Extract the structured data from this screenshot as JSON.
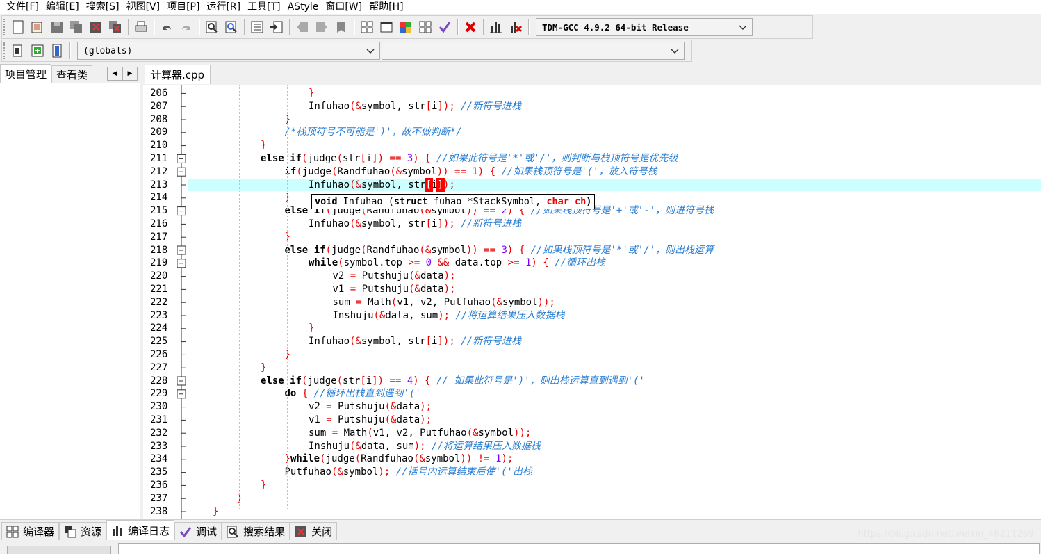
{
  "menu": [
    "文件[F]",
    "编辑[E]",
    "搜索[S]",
    "视图[V]",
    "项目[P]",
    "运行[R]",
    "工具[T]",
    "AStyle",
    "窗口[W]",
    "帮助[H]"
  ],
  "toolbar": {
    "compiler": "TDM-GCC 4.9.2 64-bit Release",
    "scope": "(globals)",
    "member": ""
  },
  "left_panel": {
    "tabs": [
      "项目管理",
      "查看类"
    ]
  },
  "editor": {
    "tab": "计算器.cpp",
    "tooltip": {
      "return_type": "void",
      "func": "Infuhao",
      "params_open": "(",
      "kw_struct": "struct",
      "p1": "fuhao *StackSymbol, ",
      "kw_char": "char",
      "p2": "ch",
      "close": ")"
    },
    "lines": [
      {
        "n": "206",
        "indent": 4,
        "code": [
          [
            "o",
            "}"
          ]
        ]
      },
      {
        "n": "207",
        "indent": 4,
        "code": [
          [
            "t",
            "Infuhao"
          ],
          [
            "o",
            "(&"
          ],
          [
            "t",
            "symbol, str"
          ],
          [
            "o",
            "["
          ],
          [
            "t",
            "i"
          ],
          [
            "o",
            "]);"
          ],
          [
            "t",
            " "
          ],
          [
            "c",
            "//新符号进栈"
          ]
        ]
      },
      {
        "n": "208",
        "indent": 3,
        "code": [
          [
            "o",
            "}"
          ]
        ]
      },
      {
        "n": "209",
        "indent": 3,
        "code": [
          [
            "c",
            "/*栈顶符号不可能是')'，故不做判断*/"
          ]
        ]
      },
      {
        "n": "210",
        "indent": 2,
        "code": [
          [
            "o",
            "}"
          ]
        ]
      },
      {
        "n": "211",
        "indent": 2,
        "code": [
          [
            "k",
            "else if"
          ],
          [
            "o",
            "("
          ],
          [
            "t",
            "judge"
          ],
          [
            "o",
            "("
          ],
          [
            "t",
            "str"
          ],
          [
            "o",
            "["
          ],
          [
            "t",
            "i"
          ],
          [
            "o",
            "])"
          ],
          [
            "t",
            " "
          ],
          [
            "o",
            "=="
          ],
          [
            "t",
            " "
          ],
          [
            "n",
            "3"
          ],
          [
            "o",
            ")"
          ],
          [
            "t",
            " "
          ],
          [
            "o",
            "{"
          ],
          [
            "t",
            " "
          ],
          [
            "c",
            "//如果此符号是'*'或'/'，则判断与栈顶符号是优先级"
          ]
        ]
      },
      {
        "n": "212",
        "indent": 3,
        "code": [
          [
            "k",
            "if"
          ],
          [
            "o",
            "("
          ],
          [
            "t",
            "judge"
          ],
          [
            "o",
            "("
          ],
          [
            "t",
            "Randfuhao"
          ],
          [
            "o",
            "(&"
          ],
          [
            "t",
            "symbol"
          ],
          [
            "o",
            "))"
          ],
          [
            "t",
            " "
          ],
          [
            "o",
            "=="
          ],
          [
            "t",
            " "
          ],
          [
            "n",
            "1"
          ],
          [
            "o",
            ")"
          ],
          [
            "t",
            " "
          ],
          [
            "o",
            "{"
          ],
          [
            "t",
            " "
          ],
          [
            "c",
            "//如果栈顶符号是'('，放入符号栈"
          ]
        ]
      },
      {
        "n": "213",
        "indent": 4,
        "current": true,
        "code": [
          [
            "t",
            "Infuhao"
          ],
          [
            "o",
            "(&"
          ],
          [
            "t",
            "symbol, str"
          ],
          [
            "h",
            "["
          ],
          [
            "t",
            "i"
          ],
          [
            "h",
            "]"
          ],
          [
            "o",
            ");"
          ]
        ]
      },
      {
        "n": "214",
        "indent": 3,
        "code": [
          [
            "o",
            "}"
          ]
        ]
      },
      {
        "n": "215",
        "indent": 3,
        "code": [
          [
            "k",
            "else if"
          ],
          [
            "o",
            "("
          ],
          [
            "t",
            "judge"
          ],
          [
            "o",
            "("
          ],
          [
            "t",
            "Randfuhao"
          ],
          [
            "o",
            "(&"
          ],
          [
            "t",
            "symbol"
          ],
          [
            "o",
            "))"
          ],
          [
            "t",
            " "
          ],
          [
            "o",
            "=="
          ],
          [
            "t",
            " "
          ],
          [
            "n",
            "2"
          ],
          [
            "o",
            ")"
          ],
          [
            "t",
            " "
          ],
          [
            "o",
            "{"
          ],
          [
            "t",
            " "
          ],
          [
            "c",
            "//如果栈顶符号是'+'或'-'，则进符号栈"
          ]
        ]
      },
      {
        "n": "216",
        "indent": 4,
        "code": [
          [
            "t",
            "Infuhao"
          ],
          [
            "o",
            "(&"
          ],
          [
            "t",
            "symbol, str"
          ],
          [
            "o",
            "["
          ],
          [
            "t",
            "i"
          ],
          [
            "o",
            "]);"
          ],
          [
            "t",
            " "
          ],
          [
            "c",
            "//新符号进栈"
          ]
        ]
      },
      {
        "n": "217",
        "indent": 3,
        "code": [
          [
            "o",
            "}"
          ]
        ]
      },
      {
        "n": "218",
        "indent": 3,
        "code": [
          [
            "k",
            "else if"
          ],
          [
            "o",
            "("
          ],
          [
            "t",
            "judge"
          ],
          [
            "o",
            "("
          ],
          [
            "t",
            "Randfuhao"
          ],
          [
            "o",
            "(&"
          ],
          [
            "t",
            "symbol"
          ],
          [
            "o",
            "))"
          ],
          [
            "t",
            " "
          ],
          [
            "o",
            "=="
          ],
          [
            "t",
            " "
          ],
          [
            "n",
            "3"
          ],
          [
            "o",
            ")"
          ],
          [
            "t",
            " "
          ],
          [
            "o",
            "{"
          ],
          [
            "t",
            " "
          ],
          [
            "c",
            "//如果栈顶符号是'*'或'/'，则出栈运算"
          ]
        ]
      },
      {
        "n": "219",
        "indent": 4,
        "code": [
          [
            "k",
            "while"
          ],
          [
            "o",
            "("
          ],
          [
            "t",
            "symbol.top "
          ],
          [
            "o",
            ">="
          ],
          [
            "t",
            " "
          ],
          [
            "n",
            "0"
          ],
          [
            "t",
            " "
          ],
          [
            "o",
            "&&"
          ],
          [
            "t",
            " data.top "
          ],
          [
            "o",
            ">="
          ],
          [
            "t",
            " "
          ],
          [
            "n",
            "1"
          ],
          [
            "o",
            ")"
          ],
          [
            "t",
            " "
          ],
          [
            "o",
            "{"
          ],
          [
            "t",
            " "
          ],
          [
            "c",
            "//循环出栈"
          ]
        ]
      },
      {
        "n": "220",
        "indent": 5,
        "code": [
          [
            "t",
            "v2 "
          ],
          [
            "o",
            "="
          ],
          [
            "t",
            " Putshuju"
          ],
          [
            "o",
            "(&"
          ],
          [
            "t",
            "data"
          ],
          [
            "o",
            ");"
          ]
        ]
      },
      {
        "n": "221",
        "indent": 5,
        "code": [
          [
            "t",
            "v1 "
          ],
          [
            "o",
            "="
          ],
          [
            "t",
            " Putshuju"
          ],
          [
            "o",
            "(&"
          ],
          [
            "t",
            "data"
          ],
          [
            "o",
            ");"
          ]
        ]
      },
      {
        "n": "222",
        "indent": 5,
        "code": [
          [
            "t",
            "sum "
          ],
          [
            "o",
            "="
          ],
          [
            "t",
            " Math"
          ],
          [
            "o",
            "("
          ],
          [
            "t",
            "v1, v2, Putfuhao"
          ],
          [
            "o",
            "(&"
          ],
          [
            "t",
            "symbol"
          ],
          [
            "o",
            "));"
          ]
        ]
      },
      {
        "n": "223",
        "indent": 5,
        "code": [
          [
            "t",
            "Inshuju"
          ],
          [
            "o",
            "(&"
          ],
          [
            "t",
            "data, sum"
          ],
          [
            "o",
            ");"
          ],
          [
            "t",
            " "
          ],
          [
            "c",
            "//将运算结果压入数据栈"
          ]
        ]
      },
      {
        "n": "224",
        "indent": 4,
        "code": [
          [
            "o",
            "}"
          ]
        ]
      },
      {
        "n": "225",
        "indent": 4,
        "code": [
          [
            "t",
            "Infuhao"
          ],
          [
            "o",
            "(&"
          ],
          [
            "t",
            "symbol, str"
          ],
          [
            "o",
            "["
          ],
          [
            "t",
            "i"
          ],
          [
            "o",
            "]);"
          ],
          [
            "t",
            " "
          ],
          [
            "c",
            "//新符号进栈"
          ]
        ]
      },
      {
        "n": "226",
        "indent": 3,
        "code": [
          [
            "o",
            "}"
          ]
        ]
      },
      {
        "n": "227",
        "indent": 2,
        "code": [
          [
            "o",
            "}"
          ]
        ]
      },
      {
        "n": "228",
        "indent": 2,
        "code": [
          [
            "k",
            "else if"
          ],
          [
            "o",
            "("
          ],
          [
            "t",
            "judge"
          ],
          [
            "o",
            "("
          ],
          [
            "t",
            "str"
          ],
          [
            "o",
            "["
          ],
          [
            "t",
            "i"
          ],
          [
            "o",
            "])"
          ],
          [
            "t",
            " "
          ],
          [
            "o",
            "=="
          ],
          [
            "t",
            " "
          ],
          [
            "n",
            "4"
          ],
          [
            "o",
            ")"
          ],
          [
            "t",
            " "
          ],
          [
            "o",
            "{"
          ],
          [
            "t",
            " "
          ],
          [
            "c",
            "// 如果此符号是')'，则出栈运算直到遇到'('"
          ]
        ]
      },
      {
        "n": "229",
        "indent": 3,
        "code": [
          [
            "k",
            "do"
          ],
          [
            "t",
            " "
          ],
          [
            "o",
            "{"
          ],
          [
            "t",
            " "
          ],
          [
            "c",
            "//循环出栈直到遇到'('"
          ]
        ]
      },
      {
        "n": "230",
        "indent": 4,
        "code": [
          [
            "t",
            "v2 "
          ],
          [
            "o",
            "="
          ],
          [
            "t",
            " Putshuju"
          ],
          [
            "o",
            "(&"
          ],
          [
            "t",
            "data"
          ],
          [
            "o",
            ");"
          ]
        ]
      },
      {
        "n": "231",
        "indent": 4,
        "code": [
          [
            "t",
            "v1 "
          ],
          [
            "o",
            "="
          ],
          [
            "t",
            " Putshuju"
          ],
          [
            "o",
            "(&"
          ],
          [
            "t",
            "data"
          ],
          [
            "o",
            ");"
          ]
        ]
      },
      {
        "n": "232",
        "indent": 4,
        "code": [
          [
            "t",
            "sum "
          ],
          [
            "o",
            "="
          ],
          [
            "t",
            " Math"
          ],
          [
            "o",
            "("
          ],
          [
            "t",
            "v1, v2, Putfuhao"
          ],
          [
            "o",
            "(&"
          ],
          [
            "t",
            "symbol"
          ],
          [
            "o",
            "));"
          ]
        ]
      },
      {
        "n": "233",
        "indent": 4,
        "code": [
          [
            "t",
            "Inshuju"
          ],
          [
            "o",
            "(&"
          ],
          [
            "t",
            "data, sum"
          ],
          [
            "o",
            ");"
          ],
          [
            "t",
            " "
          ],
          [
            "c",
            "//将运算结果压入数据栈"
          ]
        ]
      },
      {
        "n": "234",
        "indent": 3,
        "code": [
          [
            "o",
            "}"
          ],
          [
            "k",
            "while"
          ],
          [
            "o",
            "("
          ],
          [
            "t",
            "judge"
          ],
          [
            "o",
            "("
          ],
          [
            "t",
            "Randfuhao"
          ],
          [
            "o",
            "(&"
          ],
          [
            "t",
            "symbol"
          ],
          [
            "o",
            "))"
          ],
          [
            "t",
            " "
          ],
          [
            "o",
            "!="
          ],
          [
            "t",
            " "
          ],
          [
            "n",
            "1"
          ],
          [
            "o",
            ");"
          ]
        ]
      },
      {
        "n": "235",
        "indent": 3,
        "code": [
          [
            "t",
            "Putfuhao"
          ],
          [
            "o",
            "(&"
          ],
          [
            "t",
            "symbol"
          ],
          [
            "o",
            ");"
          ],
          [
            "t",
            " "
          ],
          [
            "c",
            "//括号内运算结束后使'('出栈"
          ]
        ]
      },
      {
        "n": "236",
        "indent": 2,
        "code": [
          [
            "o",
            "}"
          ]
        ]
      },
      {
        "n": "237",
        "indent": 1,
        "code": [
          [
            "o",
            "}"
          ]
        ]
      },
      {
        "n": "238",
        "indent": 0,
        "code": [
          [
            "o",
            "}"
          ]
        ]
      }
    ]
  },
  "bottom_tabs": [
    {
      "label": "编译器",
      "icon": "compiler-icon"
    },
    {
      "label": "资源",
      "icon": "resources-icon"
    },
    {
      "label": "编译日志",
      "icon": "compile-log-icon"
    },
    {
      "label": "调试",
      "icon": "debug-icon"
    },
    {
      "label": "搜索结果",
      "icon": "search-results-icon"
    },
    {
      "label": "关闭",
      "icon": "close-icon"
    }
  ],
  "watermark": "https://blog.csdn.net/weixin_46211269"
}
